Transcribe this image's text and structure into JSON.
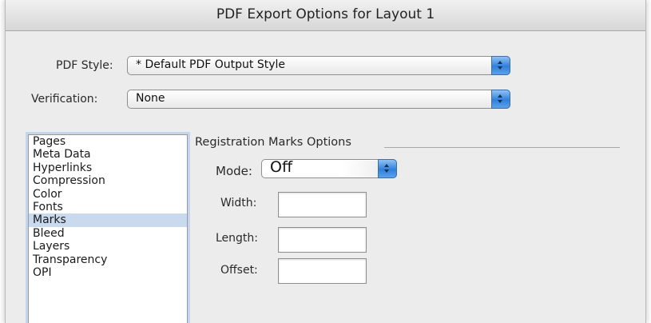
{
  "window": {
    "title": "PDF Export Options for Layout 1"
  },
  "pdf_style": {
    "label": "PDF Style:",
    "value": "* Default PDF Output Style"
  },
  "verification": {
    "label": "Verification:",
    "value": "None"
  },
  "categories": {
    "items": [
      "Pages",
      "Meta Data",
      "Hyperlinks",
      "Compression",
      "Color",
      "Fonts",
      "Marks",
      "Bleed",
      "Layers",
      "Transparency",
      "OPI"
    ],
    "selected": "Marks"
  },
  "registration": {
    "group_label": "Registration Marks Options",
    "mode_label": "Mode:",
    "mode_value": "Off",
    "width_label": "Width:",
    "width_value": "",
    "length_label": "Length:",
    "length_value": "",
    "offset_label": "Offset:",
    "offset_value": ""
  },
  "colors": {
    "selection": "#c9d9ee",
    "stepper": "#2f7fdc",
    "dialog_bg": "#ececec"
  }
}
